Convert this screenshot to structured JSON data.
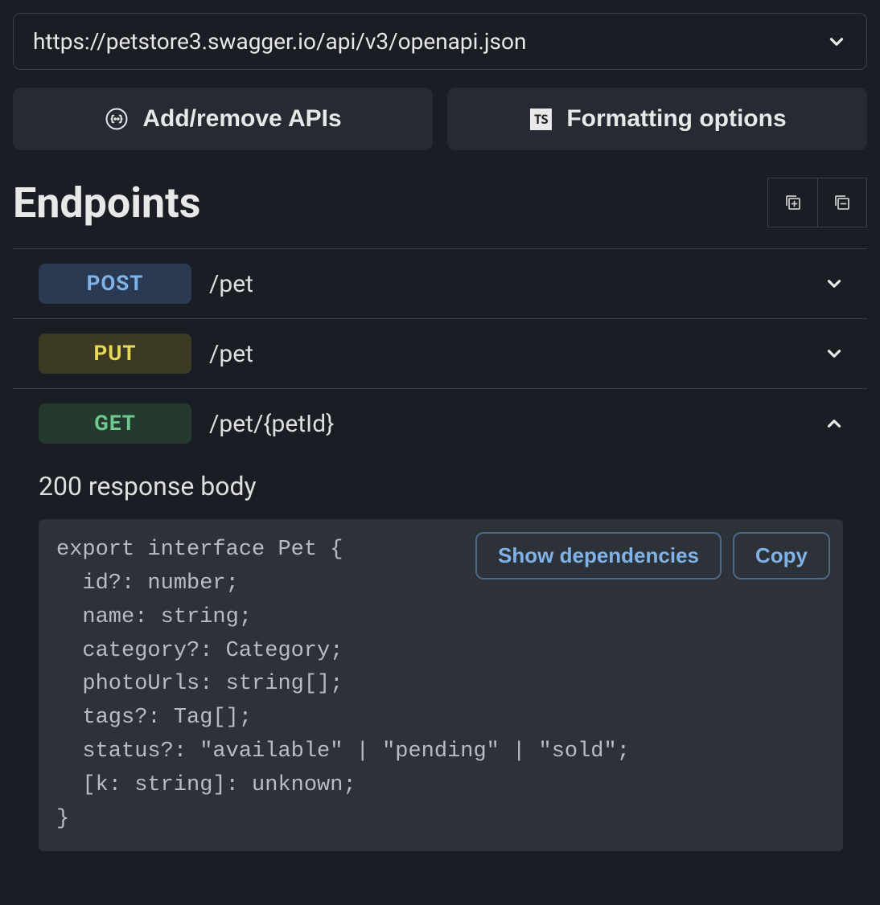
{
  "url_select": {
    "value": "https://petstore3.swagger.io/api/v3/openapi.json"
  },
  "toolbar": {
    "add_remove_apis_label": "Add/remove APIs",
    "formatting_options_label": "Formatting options",
    "ts_badge": "TS"
  },
  "section": {
    "title": "Endpoints"
  },
  "endpoints": [
    {
      "method": "POST",
      "path": "/pet",
      "expanded": false
    },
    {
      "method": "PUT",
      "path": "/pet",
      "expanded": false
    },
    {
      "method": "GET",
      "path": "/pet/{petId}",
      "expanded": true
    }
  ],
  "response": {
    "title": "200 response body",
    "code": "export interface Pet {\n  id?: number;\n  name: string;\n  category?: Category;\n  photoUrls: string[];\n  tags?: Tag[];\n  status?: \"available\" | \"pending\" | \"sold\";\n  [k: string]: unknown;\n}",
    "show_dependencies_label": "Show dependencies",
    "copy_label": "Copy"
  }
}
